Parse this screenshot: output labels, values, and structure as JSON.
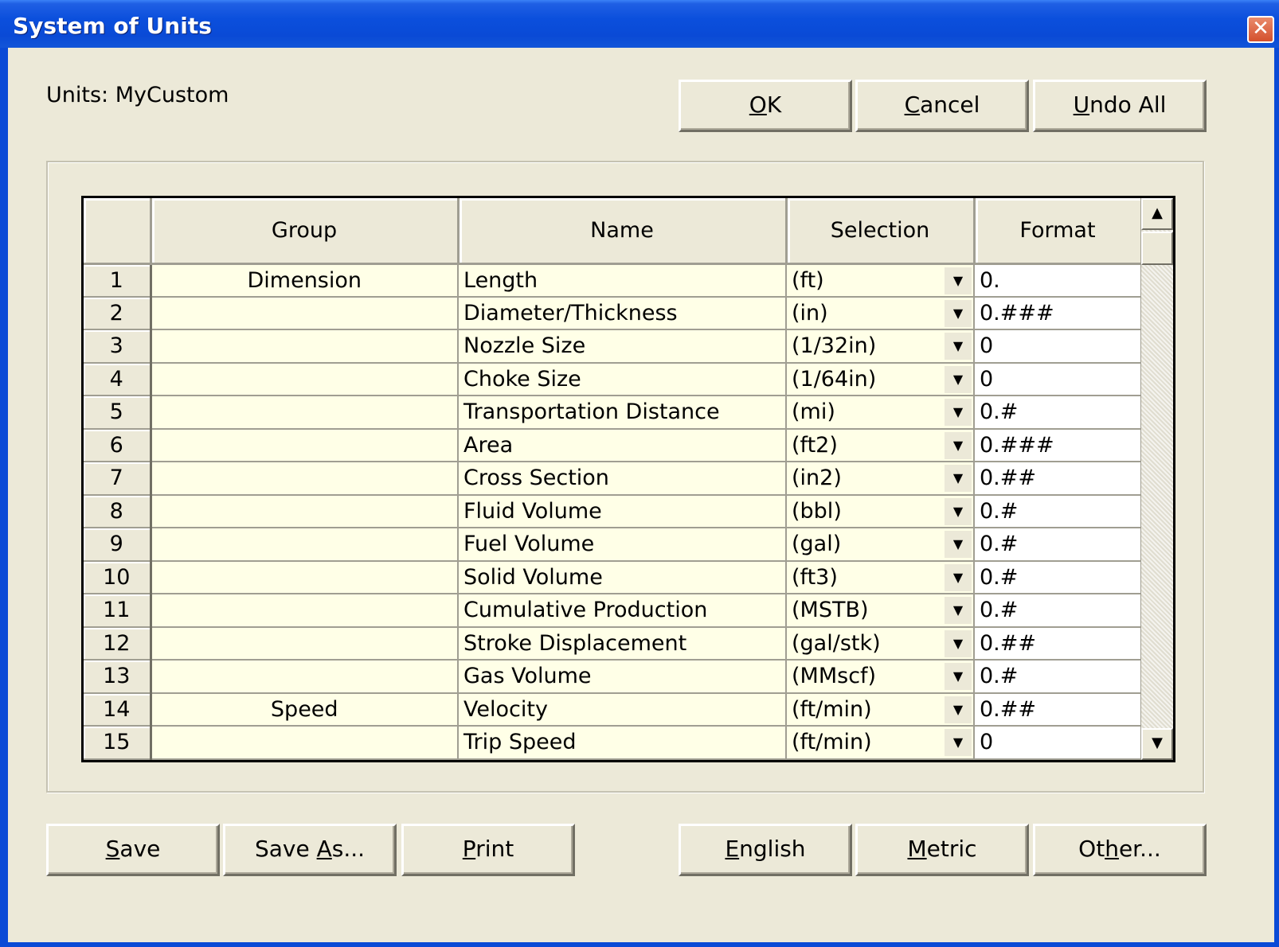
{
  "window": {
    "title": "System of Units",
    "close_glyph": "✕"
  },
  "units_label": "Units: MyCustom",
  "top_buttons": {
    "ok": {
      "pre": "",
      "u": "O",
      "post": "K"
    },
    "cancel": {
      "pre": "",
      "u": "C",
      "post": "ancel"
    },
    "undo_all": {
      "pre": "",
      "u": "U",
      "post": "ndo All"
    }
  },
  "table": {
    "columns": [
      "",
      "Group",
      "Name",
      "Selection",
      "Format"
    ],
    "rows": [
      {
        "num": "1",
        "group": "Dimension",
        "name": "Length",
        "selection": "(ft)",
        "format": "0."
      },
      {
        "num": "2",
        "group": "",
        "name": "Diameter/Thickness",
        "selection": "(in)",
        "format": "0.###"
      },
      {
        "num": "3",
        "group": "",
        "name": "Nozzle Size",
        "selection": "(1/32in)",
        "format": "0"
      },
      {
        "num": "4",
        "group": "",
        "name": "Choke Size",
        "selection": "(1/64in)",
        "format": "0"
      },
      {
        "num": "5",
        "group": "",
        "name": "Transportation Distance",
        "selection": "(mi)",
        "format": "0.#"
      },
      {
        "num": "6",
        "group": "",
        "name": "Area",
        "selection": "(ft2)",
        "format": "0.###"
      },
      {
        "num": "7",
        "group": "",
        "name": "Cross Section",
        "selection": "(in2)",
        "format": "0.##"
      },
      {
        "num": "8",
        "group": "",
        "name": "Fluid Volume",
        "selection": "(bbl)",
        "format": "0.#"
      },
      {
        "num": "9",
        "group": "",
        "name": "Fuel Volume",
        "selection": "(gal)",
        "format": "0.#"
      },
      {
        "num": "10",
        "group": "",
        "name": "Solid Volume",
        "selection": "(ft3)",
        "format": "0.#"
      },
      {
        "num": "11",
        "group": "",
        "name": "Cumulative Production",
        "selection": "(MSTB)",
        "format": "0.#"
      },
      {
        "num": "12",
        "group": "",
        "name": "Stroke Displacement",
        "selection": "(gal/stk)",
        "format": "0.##"
      },
      {
        "num": "13",
        "group": "",
        "name": "Gas Volume",
        "selection": "(MMscf)",
        "format": "0.#"
      },
      {
        "num": "14",
        "group": "Speed",
        "name": "Velocity",
        "selection": "(ft/min)",
        "format": "0.##"
      },
      {
        "num": "15",
        "group": "",
        "name": "Trip Speed",
        "selection": "(ft/min)",
        "format": "0"
      }
    ]
  },
  "scroll": {
    "up": "▲",
    "down": "▼"
  },
  "dropdown_glyph": "▼",
  "bottom_buttons": {
    "save": {
      "pre": "",
      "u": "S",
      "post": "ave"
    },
    "save_as": {
      "pre": "Save ",
      "u": "A",
      "post": "s..."
    },
    "print": {
      "pre": "",
      "u": "P",
      "post": "rint"
    },
    "english": {
      "pre": "",
      "u": "E",
      "post": "nglish"
    },
    "metric": {
      "pre": "",
      "u": "M",
      "post": "etric"
    },
    "other": {
      "pre": "Ot",
      "u": "h",
      "post": "er..."
    }
  }
}
